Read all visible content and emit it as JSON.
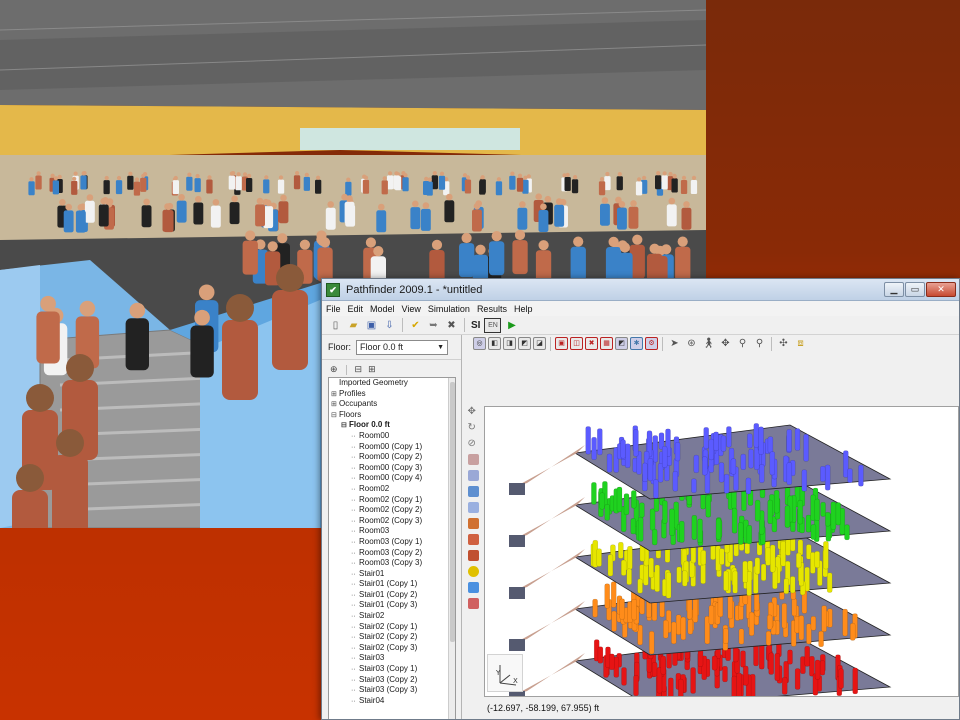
{
  "window": {
    "title": "Pathfinder 2009.1 - *untitled",
    "app_icon": "pathfinder-app-icon",
    "buttons": [
      "minimize",
      "maximize",
      "close"
    ]
  },
  "menu": [
    "File",
    "Edit",
    "Model",
    "View",
    "Simulation",
    "Results",
    "Help"
  ],
  "toolbar": {
    "si_label": "SI",
    "en_label": "EN",
    "icons": [
      "new-icon",
      "open-icon",
      "save-icon",
      "import-icon",
      "check-icon",
      "undo-icon",
      "close-icon",
      "run-icon"
    ]
  },
  "floor": {
    "label": "Floor:",
    "selected": "Floor 0.0 ft"
  },
  "tree": [
    {
      "label": "Imported Geometry",
      "level": 0,
      "expander": ""
    },
    {
      "label": "Profiles",
      "level": 0,
      "expander": "+"
    },
    {
      "label": "Occupants",
      "level": 0,
      "expander": "+"
    },
    {
      "label": "Floors",
      "level": 0,
      "expander": "−"
    },
    {
      "label": "Floor 0.0 ft",
      "level": 1,
      "expander": "−",
      "bold": true
    },
    {
      "label": "Room00",
      "level": 2
    },
    {
      "label": "Room00 (Copy 1)",
      "level": 2
    },
    {
      "label": "Room00 (Copy 2)",
      "level": 2
    },
    {
      "label": "Room00 (Copy 3)",
      "level": 2
    },
    {
      "label": "Room00 (Copy 4)",
      "level": 2
    },
    {
      "label": "Room02",
      "level": 2
    },
    {
      "label": "Room02 (Copy 1)",
      "level": 2
    },
    {
      "label": "Room02 (Copy 2)",
      "level": 2
    },
    {
      "label": "Room02 (Copy 3)",
      "level": 2
    },
    {
      "label": "Room03",
      "level": 2
    },
    {
      "label": "Room03 (Copy 1)",
      "level": 2
    },
    {
      "label": "Room03 (Copy 2)",
      "level": 2
    },
    {
      "label": "Room03 (Copy 3)",
      "level": 2
    },
    {
      "label": "Stair01",
      "level": 2
    },
    {
      "label": "Stair01 (Copy 1)",
      "level": 2
    },
    {
      "label": "Stair01 (Copy 2)",
      "level": 2
    },
    {
      "label": "Stair01 (Copy 3)",
      "level": 2
    },
    {
      "label": "Stair02",
      "level": 2
    },
    {
      "label": "Stair02 (Copy 1)",
      "level": 2
    },
    {
      "label": "Stair02 (Copy 2)",
      "level": 2
    },
    {
      "label": "Stair02 (Copy 3)",
      "level": 2
    },
    {
      "label": "Stair03",
      "level": 2
    },
    {
      "label": "Stair03 (Copy 1)",
      "level": 2
    },
    {
      "label": "Stair03 (Copy 2)",
      "level": 2
    },
    {
      "label": "Stair03 (Copy 3)",
      "level": 2
    },
    {
      "label": "Stair04",
      "level": 2
    }
  ],
  "status": {
    "coordinates": "(-12.697, -58.199, 67.955) ft"
  },
  "floors_colors": [
    "#5b5bff",
    "#1fd21f",
    "#e6e600",
    "#ff8c1a",
    "#e61414"
  ],
  "colors": {
    "background_top": "#7a2a0a",
    "background_bottom": "#c83200"
  }
}
